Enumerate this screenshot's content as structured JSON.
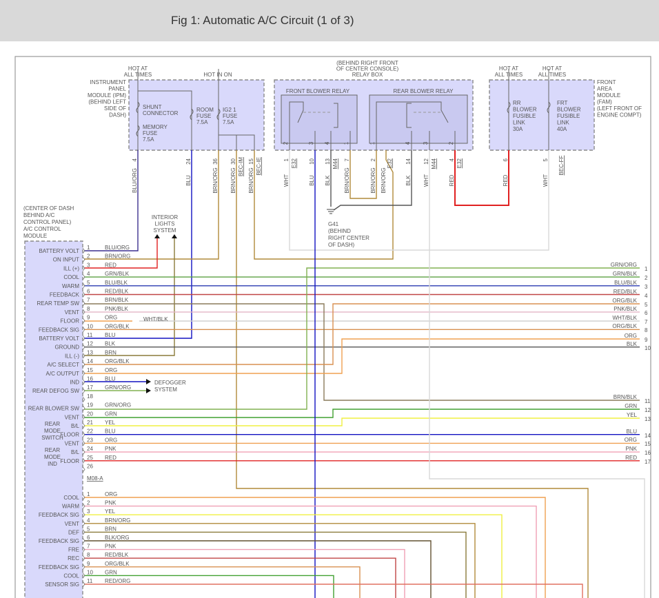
{
  "header": {
    "title": "Fig 1: Automatic A/C Circuit (1 of 3)"
  },
  "ipm": {
    "hot_all": [
      "HOT AT",
      "ALL TIMES"
    ],
    "hot_on": "HOT IN ON",
    "name": [
      "INSTRUMENT",
      "PANEL",
      "MODULE (IPM)",
      "(BEHIND LEFT",
      "SIDE OF",
      "DASH)"
    ],
    "shunt": [
      "SHUNT",
      "CONNECTOR"
    ],
    "memory": [
      "MEMORY",
      "FUSE",
      "7.5A"
    ],
    "room": [
      "ROOM",
      "FUSE",
      "7.5A"
    ],
    "ig2": [
      "IG2 1",
      "FUSE",
      "7.5A"
    ],
    "pins": [
      {
        "num": "4",
        "color": "BLU/ORG"
      },
      {
        "num": "24",
        "color": "BLU"
      },
      {
        "num": "36",
        "color": "BRN/ORG"
      },
      {
        "num": "30",
        "color": "BRN/ORG",
        "conn": "BEC-IM"
      },
      {
        "num": "15",
        "color": "BRN/ORG",
        "conn": "BEC-IE"
      }
    ]
  },
  "relay_box": {
    "location": [
      "(BEHIND RIGHT FRONT",
      "OF CENTER CONSOLE)",
      "RELAY BOX"
    ],
    "front": "FRONT BLOWER RELAY",
    "rear": "REAR BLOWER RELAY",
    "inner_pins": [
      "2",
      "3",
      "4",
      "1",
      "1",
      "4",
      "3",
      "2"
    ],
    "pins": [
      {
        "num": "1",
        "color": "WHT",
        "conn": "E32"
      },
      {
        "num": "10",
        "color": "BLU"
      },
      {
        "num": "13",
        "color": "BLK",
        "conn": "M44"
      },
      {
        "num": "7",
        "color": "BRN/ORG"
      },
      {
        "num": "2",
        "color": "BRN/ORG",
        "color2": "BRN/ORG",
        "conn": "E32"
      },
      {
        "num": "14",
        "color": "BLK"
      },
      {
        "num": "12",
        "color": "WHT",
        "conn": "M44"
      },
      {
        "num": "4",
        "color": "RED",
        "conn": "E32"
      }
    ]
  },
  "ground": {
    "id": "G41",
    "loc": [
      "(BEHIND",
      "RIGHT CENTER",
      "OF DASH)"
    ]
  },
  "fam": {
    "hot1": [
      "HOT AT",
      "ALL TIMES"
    ],
    "hot2": [
      "HOT AT",
      "ALL TIMES"
    ],
    "name": [
      "FRONT",
      "AREA",
      "MODULE",
      "(FAM)",
      "(LEFT FRONT OF",
      "ENGINE COMPT)"
    ],
    "rr": [
      "RR",
      "BLOWER",
      "FUSIBLE",
      "LINK",
      "30A"
    ],
    "frt": [
      "FRT",
      "BLOWER",
      "FUSIBLE",
      "LINK",
      "40A"
    ],
    "pins": [
      {
        "num": "6",
        "color": "RED"
      },
      {
        "num": "5",
        "color": "WHT",
        "conn": "BEC-FF"
      }
    ]
  },
  "module": {
    "name": [
      "(CENTER OF DASH",
      "BEHIND A/C",
      "CONTROL PANEL)",
      "A/C CONTROL",
      "MODULE"
    ],
    "interior": [
      "INTERIOR",
      "LIGHTS",
      "SYSTEM"
    ],
    "defogger": [
      "DEFOGGER",
      "SYSTEM"
    ],
    "splice_color": "WHT/BLK",
    "group_rear_mode_switch": [
      "REAR",
      "MODE",
      "SWITCH"
    ],
    "group_rear_mode_ind": [
      "REAR",
      "MODE",
      "IND"
    ],
    "conn_b": "M08-A",
    "pins_a": [
      {
        "num": "1",
        "label": "BATTERY VOLT",
        "color": "BLU/ORG"
      },
      {
        "num": "2",
        "label": "ON INPUT",
        "color": "BRN/ORG"
      },
      {
        "num": "3",
        "label": "ILL (+)",
        "color": "RED"
      },
      {
        "num": "4",
        "label": "COOL",
        "color": "GRN/BLK"
      },
      {
        "num": "5",
        "label": "WARM",
        "color": "BLU/BLK"
      },
      {
        "num": "6",
        "label": "FEEDBACK",
        "color": "RED/BLK"
      },
      {
        "num": "7",
        "label": "REAR TEMP SW",
        "color": "BRN/BLK"
      },
      {
        "num": "8",
        "label": "VENT",
        "color": "PNK/BLK"
      },
      {
        "num": "9",
        "label": "FLOOR",
        "color": "ORG"
      },
      {
        "num": "10",
        "label": "FEEDBACK SIG",
        "color": "ORG/BLK"
      },
      {
        "num": "11",
        "label": "BATTERY VOLT",
        "color": "BLU"
      },
      {
        "num": "12",
        "label": "GROUND",
        "color": "BLK"
      },
      {
        "num": "13",
        "label": "ILL (-)",
        "color": "BRN"
      },
      {
        "num": "14",
        "label": "A/C SELECT",
        "color": "ORG/BLK"
      },
      {
        "num": "15",
        "label": "A/C OUTPUT",
        "color": "ORG"
      },
      {
        "num": "16",
        "label": "IND",
        "color": "BLU"
      },
      {
        "num": "17",
        "label": "REAR DEFOG SW",
        "color": "GRN/ORG"
      },
      {
        "num": "18",
        "label": "",
        "color": ""
      },
      {
        "num": "19",
        "label": "REAR BLOWER SW",
        "color": "GRN/ORG"
      },
      {
        "num": "20",
        "label": "VENT",
        "color": "GRN"
      },
      {
        "num": "21",
        "label": "B/L",
        "color": "YEL"
      },
      {
        "num": "22",
        "label": "FLOOR",
        "color": "BLU"
      },
      {
        "num": "23",
        "label": "VENT",
        "color": "ORG"
      },
      {
        "num": "24",
        "label": "B/L",
        "color": "PNK"
      },
      {
        "num": "25",
        "label": "FLOOR",
        "color": "RED"
      },
      {
        "num": "26",
        "label": "",
        "color": ""
      }
    ],
    "pins_b": [
      {
        "num": "1",
        "label": "COOL",
        "color": "ORG"
      },
      {
        "num": "2",
        "label": "WARM",
        "color": "PNK"
      },
      {
        "num": "3",
        "label": "FEEDBACK SIG",
        "color": "YEL"
      },
      {
        "num": "4",
        "label": "VENT",
        "color": "BRN/ORG"
      },
      {
        "num": "5",
        "label": "DEF",
        "color": "BRN"
      },
      {
        "num": "6",
        "label": "FEEDBACK SIG",
        "color": "BLK/ORG"
      },
      {
        "num": "7",
        "label": "FRE",
        "color": "PNK"
      },
      {
        "num": "8",
        "label": "REC",
        "color": "RED/BLK"
      },
      {
        "num": "9",
        "label": "FEEDBACK SIG",
        "color": "ORG/BLK"
      },
      {
        "num": "10",
        "label": "COOL",
        "color": "GRN"
      },
      {
        "num": "11",
        "label": "SENSOR SIG",
        "color": "RED/ORG"
      }
    ]
  },
  "right_refs": [
    {
      "num": "1",
      "color": "GRN/ORG"
    },
    {
      "num": "2",
      "color": "GRN/BLK"
    },
    {
      "num": "3",
      "color": "BLU/BLK"
    },
    {
      "num": "4",
      "color": "RED/BLK"
    },
    {
      "num": "5",
      "color": "ORG/BLK"
    },
    {
      "num": "6",
      "color": "PNK/BLK"
    },
    {
      "num": "7",
      "color": "WHT/BLK"
    },
    {
      "num": "8",
      "color": "ORG/BLK"
    },
    {
      "num": "9",
      "color": "ORG"
    },
    {
      "num": "10",
      "color": "BLK"
    },
    {
      "num": "11",
      "color": "BRN/BLK"
    },
    {
      "num": "12",
      "color": "GRN"
    },
    {
      "num": "13",
      "color": "YEL"
    },
    {
      "num": "14",
      "color": "BLU"
    },
    {
      "num": "15",
      "color": "ORG"
    },
    {
      "num": "16",
      "color": "PNK"
    },
    {
      "num": "17",
      "color": "RED"
    }
  ],
  "wire_colors": {
    "BLU/ORG": "#3b2f8f",
    "BRN/ORG": "#b08a3a",
    "RED": "#e02020",
    "GRN/BLK": "#5aa040",
    "BLU/BLK": "#2a3ab0",
    "RED/BLK": "#c04545",
    "BRN/BLK": "#8a7a5a",
    "PNK/BLK": "#e3b5c5",
    "ORG": "#f0a050",
    "WHT/BLK": "#d0d0d0",
    "ORG/BLK": "#d89050",
    "BLU": "#1010c0",
    "BLK": "#555555",
    "BRN": "#8a7a3a",
    "GRN/ORG": "#80b050",
    "GRN": "#40a030",
    "YEL": "#f0f040",
    "PNK": "#f0a0b5",
    "BLK/ORG": "#605030",
    "RED/ORG": "#e07060",
    "WHT": "#d8d8d8"
  }
}
